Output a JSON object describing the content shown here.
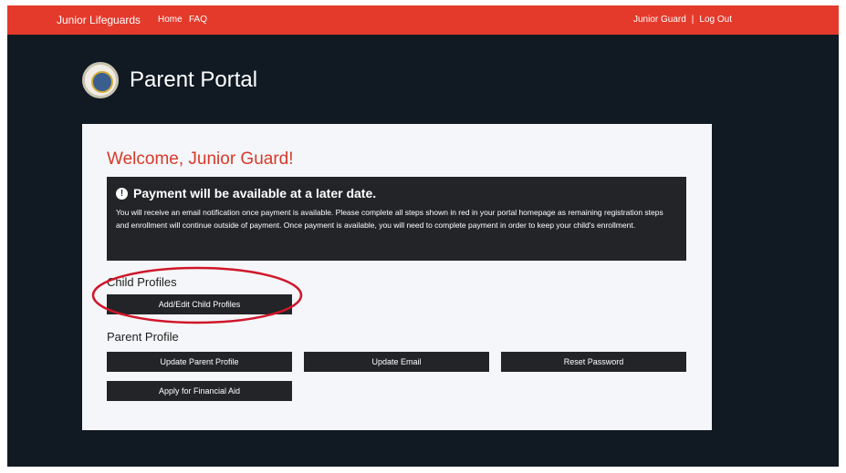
{
  "header": {
    "brand": "Junior Lifeguards",
    "nav": [
      "Home",
      "FAQ"
    ],
    "user_name": "Junior Guard",
    "separator": "|",
    "logout": "Log Out"
  },
  "portal": {
    "title": "Parent Portal",
    "logo_icon": "seal-logo-icon"
  },
  "main": {
    "welcome": "Welcome, Junior Guard!",
    "notice": {
      "icon": "info-icon",
      "title": "Payment will be available at a later date.",
      "body": "You will receive an email notification once payment is available. Please complete all steps shown in red in your portal homepage as remaining registration steps and enrollment will continue outside of payment. Once payment is available, you will need to complete payment in order to keep your child's enrollment."
    },
    "child_profiles": {
      "title": "Child Profiles",
      "button": "Add/Edit Child Profiles"
    },
    "parent_profile": {
      "title": "Parent Profile",
      "buttons": [
        "Update Parent Profile",
        "Update Email",
        "Reset Password",
        "Apply for Financial Aid"
      ]
    }
  },
  "colors": {
    "header_bg": "#e43a2c",
    "page_bg": "#111923",
    "card_bg": "#f5f6f9",
    "button_bg": "#222428",
    "welcome_text": "#d63a29",
    "annotation": "#d0162a"
  }
}
